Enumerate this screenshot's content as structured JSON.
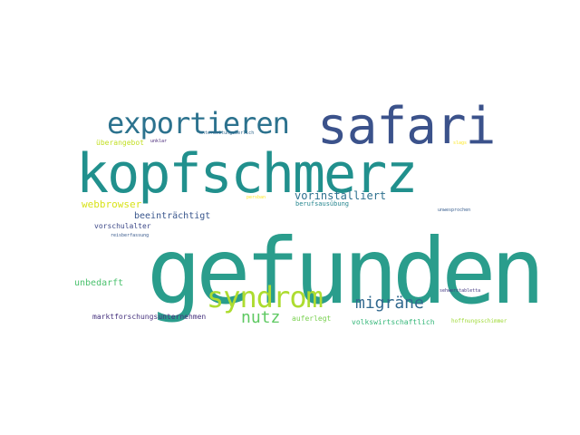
{
  "words": [
    {
      "text": "gefunden",
      "color": "#2a9d8c"
    },
    {
      "text": "kopfschmerz",
      "color": "#21908d"
    },
    {
      "text": "safari",
      "color": "#3b528b"
    },
    {
      "text": "exportieren",
      "color": "#2c728e"
    },
    {
      "text": "syndrom",
      "color": "#addc30"
    },
    {
      "text": "migräne",
      "color": "#31688e"
    },
    {
      "text": "nutz",
      "color": "#5ec962"
    },
    {
      "text": "vorinstalliert",
      "color": "#2d708e"
    },
    {
      "text": "webbrowser",
      "color": "#d8e219"
    },
    {
      "text": "beeinträchtigt",
      "color": "#39568c"
    },
    {
      "text": "berufsausübung",
      "color": "#25858e"
    },
    {
      "text": "vorschulalter",
      "color": "#3e4a89"
    },
    {
      "text": "unbedarft",
      "color": "#4ac16d"
    },
    {
      "text": "marktforschungsunternehmen",
      "color": "#46327e"
    },
    {
      "text": "auferlegt",
      "color": "#7ad151"
    },
    {
      "text": "volkswirtschaftlich",
      "color": "#35b779"
    },
    {
      "text": "überangebot",
      "color": "#c2df23"
    },
    {
      "text": "hoffnungsschimmer",
      "color": "#a0da39"
    },
    {
      "text": "reisberfassung",
      "color": "#38598c"
    },
    {
      "text": "unklar",
      "color": "#482878"
    },
    {
      "text": "unwesprochen",
      "color": "#365c8d"
    },
    {
      "text": "sehwerstabletta",
      "color": "#443983"
    },
    {
      "text": "unterweitungsberlich",
      "color": "#31688e"
    },
    {
      "text": "persban",
      "color": "#fde725"
    },
    {
      "text": "slags",
      "color": "#fde725"
    }
  ]
}
